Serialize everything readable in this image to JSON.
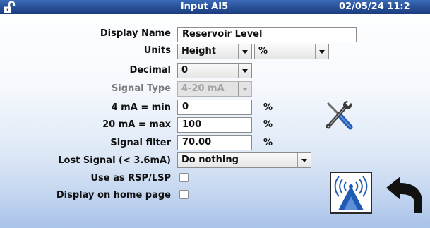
{
  "header": {
    "title": "Input AI5",
    "datetime": "02/05/24 11:2",
    "lock_icon": "unlocked-padlock-icon"
  },
  "form": {
    "display_name": {
      "label": "Display Name",
      "value": "Reservoir Level"
    },
    "units": {
      "label": "Units",
      "type_value": "Height",
      "unit_value": "%"
    },
    "decimal": {
      "label": "Decimal",
      "value": "0"
    },
    "signal_type": {
      "label": "Signal Type",
      "value": "4-20 mA",
      "enabled": false
    },
    "min": {
      "label": "4 mA = min",
      "value": "0",
      "unit": "%"
    },
    "max": {
      "label": "20 mA = max",
      "value": "100",
      "unit": "%"
    },
    "signal_filter": {
      "label": "Signal filter",
      "value": "70.00",
      "unit": "%"
    },
    "lost_signal": {
      "label": "Lost Signal (< 3.6mA)",
      "value": "Do nothing"
    },
    "use_as_rsp": {
      "label": "Use as RSP/LSP",
      "checked": false
    },
    "display_home": {
      "label": "Display on home page",
      "checked": false
    }
  },
  "icons": {
    "tools": "tools-wrench-screwdriver-icon",
    "wireless": "wireless-tower-icon",
    "back": "back-arrow-icon"
  },
  "colors": {
    "titlebar": "#274f97",
    "background_bottom": "#a9c2e8",
    "icon_blue": "#1f5bb5"
  }
}
